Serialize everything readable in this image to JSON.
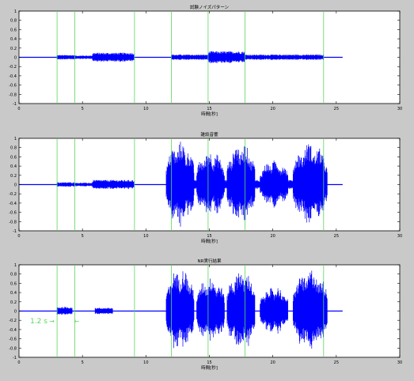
{
  "colors": {
    "figure_bg": "#c9c9c9",
    "axes_bg": "#ffffff",
    "signal": "#0000ff",
    "marker": "#5cd65c",
    "annotation": "#5cd65c"
  },
  "chart_data": [
    {
      "type": "line",
      "title": "試験ノイズパターン",
      "xlabel": "時間[秒]",
      "ylabel": "",
      "xlim": [
        0,
        30
      ],
      "ylim": [
        -1,
        1
      ],
      "xticks": [
        "0",
        "5",
        "10",
        "15",
        "20",
        "25",
        "30"
      ],
      "yticks": [
        "-1",
        "-0.8",
        "-0.6",
        "-0.4",
        "-0.2",
        "0",
        "0.2",
        "0.4",
        "0.6",
        "0.8",
        "1"
      ],
      "grid": false,
      "markers_x": [
        3,
        4.4,
        9.1,
        12,
        14.9,
        17.8,
        24
      ],
      "segments": [
        {
          "x": [
            3.0,
            4.45
          ],
          "amplitude": 0.05
        },
        {
          "x": [
            4.45,
            5.8
          ],
          "amplitude": 0.04
        },
        {
          "x": [
            5.8,
            9.05
          ],
          "amplitude": 0.1
        },
        {
          "x": [
            12.0,
            14.9
          ],
          "amplitude": 0.06
        },
        {
          "x": [
            14.9,
            17.8
          ],
          "amplitude": 0.13
        },
        {
          "x": [
            17.8,
            24.0
          ],
          "amplitude": 0.06
        }
      ],
      "signal_x_end": 25.5
    },
    {
      "type": "line",
      "title": "雑談音響",
      "xlabel": "時間[秒]",
      "ylabel": "",
      "xlim": [
        0,
        30
      ],
      "ylim": [
        -1,
        1
      ],
      "xticks": [
        "0",
        "5",
        "10",
        "15",
        "20",
        "25",
        "30"
      ],
      "yticks": [
        "-1",
        "-0.8",
        "-0.6",
        "-0.4",
        "-0.2",
        "0",
        "0.2",
        "0.4",
        "0.6",
        "0.8",
        "1"
      ],
      "grid": false,
      "markers_x": [
        3,
        4.4,
        9.1,
        12,
        14.9,
        17.8,
        24
      ],
      "segments": [
        {
          "x": [
            3.0,
            4.45
          ],
          "amplitude": 0.05
        },
        {
          "x": [
            4.45,
            5.8
          ],
          "amplitude": 0.04
        },
        {
          "x": [
            5.8,
            9.05
          ],
          "amplitude": 0.1
        },
        {
          "x": [
            11.6,
            13.8
          ],
          "amplitude": 0.95
        },
        {
          "x": [
            14.0,
            16.2
          ],
          "amplitude": 0.75
        },
        {
          "x": [
            16.4,
            18.6
          ],
          "amplitude": 0.92
        },
        {
          "x": [
            19.0,
            21.2
          ],
          "amplitude": 0.55
        },
        {
          "x": [
            21.6,
            24.3
          ],
          "amplitude": 0.92
        },
        {
          "x": [
            13.8,
            21.6
          ],
          "amplitude": 0.1
        }
      ],
      "signal_x_end": 25.5
    },
    {
      "type": "line",
      "title": "NR実行結果",
      "xlabel": "時間[秒]",
      "ylabel": "",
      "xlim": [
        0,
        30
      ],
      "ylim": [
        -1,
        1
      ],
      "xticks": [
        "0",
        "5",
        "10",
        "15",
        "20",
        "25",
        "30"
      ],
      "yticks": [
        "-1",
        "-0.8",
        "-0.6",
        "-0.4",
        "-0.2",
        "0",
        "0.2",
        "0.4",
        "0.6",
        "0.8",
        "1"
      ],
      "grid": false,
      "markers_x": [
        3,
        4.4,
        9.1,
        12,
        14.9,
        17.8,
        24
      ],
      "segments": [
        {
          "x": [
            3.0,
            4.2
          ],
          "amplitude": 0.09
        },
        {
          "x": [
            6.0,
            7.4
          ],
          "amplitude": 0.07
        },
        {
          "x": [
            11.6,
            13.8
          ],
          "amplitude": 0.95
        },
        {
          "x": [
            14.0,
            16.2
          ],
          "amplitude": 0.75
        },
        {
          "x": [
            16.4,
            18.6
          ],
          "amplitude": 0.92
        },
        {
          "x": [
            19.0,
            21.2
          ],
          "amplitude": 0.55
        },
        {
          "x": [
            21.6,
            24.3
          ],
          "amplitude": 0.92
        }
      ],
      "signal_x_end": 25.5,
      "annotation": {
        "label": "1.2 s",
        "arrow_right": "→",
        "arrow_left": "←",
        "x_start": 3.0,
        "x_end": 4.2,
        "y": -0.2
      }
    }
  ]
}
